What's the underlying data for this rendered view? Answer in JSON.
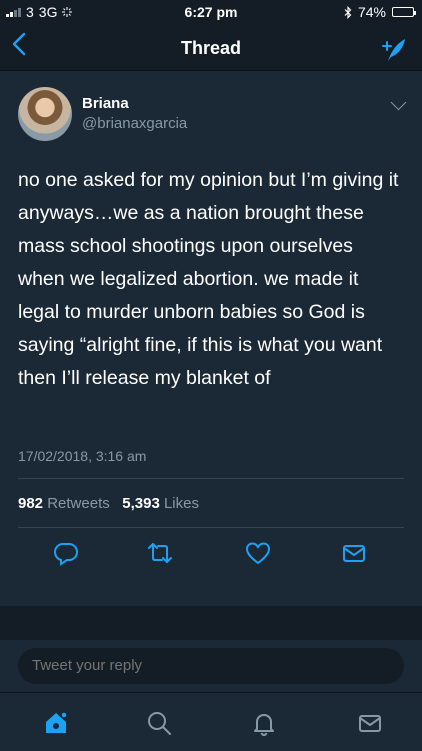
{
  "status": {
    "carrier": "3",
    "network": "3G",
    "time": "6:27 pm",
    "battery": "74%",
    "battery_level": 0.74
  },
  "nav": {
    "title": "Thread"
  },
  "tweet": {
    "author_name": "Briana",
    "author_handle": "@brianaxgarcia",
    "text": "no one asked for my opinion but I’m giving it anyways…we as a nation brought these mass school shootings upon ourselves when we legalized abortion. we made it legal to murder unborn babies so God is saying “alright fine, if this is what you want then I’ll release my blanket of",
    "timestamp": "17/02/2018, 3:16 am",
    "retweet_count": "982",
    "retweet_label": "Retweets",
    "like_count": "5,393",
    "like_label": "Likes"
  },
  "reply": {
    "placeholder": "Tweet your reply"
  },
  "colors": {
    "accent": "#1da1f2",
    "background": "#141d26",
    "card": "#1b2836",
    "muted": "#8899a6"
  },
  "icons": {
    "actions": [
      "reply-icon",
      "retweet-icon",
      "like-icon",
      "message-icon"
    ],
    "tabs": [
      "home-icon",
      "search-icon",
      "notifications-icon",
      "messages-icon"
    ]
  }
}
